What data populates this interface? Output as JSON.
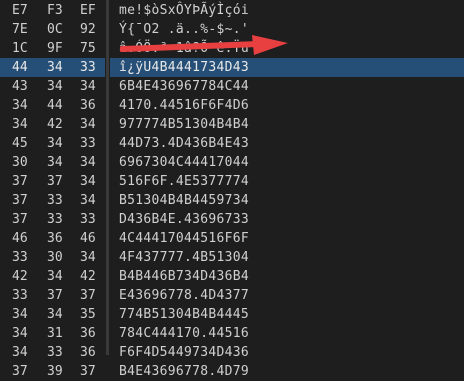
{
  "selected_row_index": 3,
  "hex_rows": [
    [
      "E7",
      "F3",
      "EF"
    ],
    [
      "7E",
      "0C",
      "92"
    ],
    [
      "1C",
      "9F",
      "75"
    ],
    [
      "44",
      "34",
      "33"
    ],
    [
      "43",
      "34",
      "34"
    ],
    [
      "34",
      "44",
      "36"
    ],
    [
      "34",
      "42",
      "34"
    ],
    [
      "45",
      "34",
      "33"
    ],
    [
      "30",
      "34",
      "34"
    ],
    [
      "37",
      "37",
      "34"
    ],
    [
      "37",
      "33",
      "34"
    ],
    [
      "37",
      "33",
      "33"
    ],
    [
      "46",
      "36",
      "46"
    ],
    [
      "33",
      "30",
      "34"
    ],
    [
      "42",
      "34",
      "42"
    ],
    [
      "33",
      "37",
      "37"
    ],
    [
      "34",
      "34",
      "35"
    ],
    [
      "34",
      "31",
      "36"
    ],
    [
      "34",
      "33",
      "36"
    ],
    [
      "37",
      "39",
      "37"
    ]
  ],
  "ascii_rows": [
    "me!$òSxÔYÞÃýÌçói",
    "Ý{¯O2 .ä..%-$~.'",
    "â.ÓÖ.ª 1â?Õ ê.Ÿu",
    "î¿ÿU4B4441734D43",
    "6B4E436967784C44",
    "4170.44516F6F4D6",
    "977774B51304B4B4",
    "44D73.4D436B4E43",
    "6967304C44417044",
    "516F6F.4E5377774",
    "B51304B4B4459734",
    "D436B4E.43696733",
    "4C44417044516F6F",
    "4F437777.4B51304",
    "B4B446B734D436B4",
    "E43696778.4D4377",
    "774B51304B4B4445",
    "784C444170.44516",
    "F6F4D5449734D436",
    "B4E43696778.4D79"
  ],
  "accent_color": "#e84040",
  "selection_color": "#264f78"
}
